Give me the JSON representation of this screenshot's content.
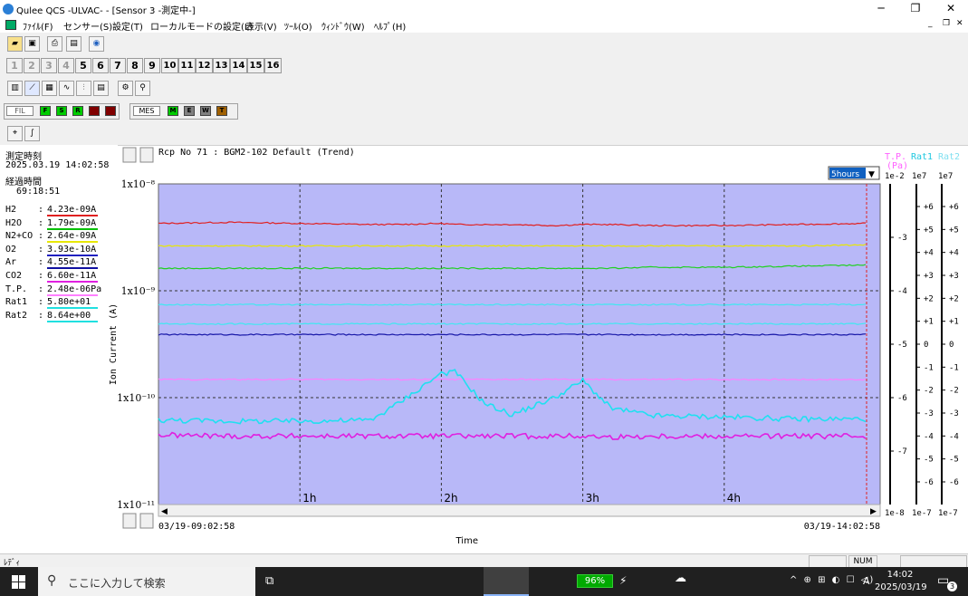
{
  "window": {
    "title": "Qulee QCS  -ULVAC-   - [Sensor 3 -測定中-]",
    "controls": {
      "minimize": "─",
      "restore": "❐",
      "close": "✕"
    }
  },
  "menu": [
    "ﾌｧｲﾙ(F)",
    "センサー(S)",
    "設定(T)",
    "ローカルモードの設定(L)",
    "表示(V)",
    "ﾂｰﾙ(O)",
    "ｳｨﾝﾄﾞｳ(W)",
    "ﾍﾙﾌﾟ(H)"
  ],
  "mdi_controls": {
    "minimize": "_",
    "restore": "❐",
    "close": "✕"
  },
  "sensor_tabs": [
    {
      "label": "1",
      "enabled": false
    },
    {
      "label": "2",
      "enabled": false
    },
    {
      "label": "3",
      "enabled": false
    },
    {
      "label": "4",
      "enabled": false
    },
    {
      "label": "5",
      "enabled": true
    },
    {
      "label": "6",
      "enabled": true
    },
    {
      "label": "7",
      "enabled": true
    },
    {
      "label": "8",
      "enabled": true
    },
    {
      "label": "9",
      "enabled": true
    },
    {
      "label": "10",
      "enabled": true
    },
    {
      "label": "11",
      "enabled": true
    },
    {
      "label": "12",
      "enabled": true
    },
    {
      "label": "13",
      "enabled": true
    },
    {
      "label": "14",
      "enabled": true
    },
    {
      "label": "15",
      "enabled": true
    },
    {
      "label": "16",
      "enabled": true
    }
  ],
  "filter_bar": {
    "fil_label": "FIL",
    "fil_chips": [
      {
        "label": "F",
        "color": "#00cc00"
      },
      {
        "label": "S",
        "color": "#00cc00"
      },
      {
        "label": "R",
        "color": "#00cc00"
      },
      {
        "label": "",
        "color": "#800000"
      },
      {
        "label": "",
        "color": "#800000"
      }
    ],
    "mes_label": "MES",
    "mes_chips": [
      {
        "label": "M",
        "color": "#00cc00"
      },
      {
        "label": "E",
        "color": "#808080"
      },
      {
        "label": "W",
        "color": "#808080"
      },
      {
        "label": "T",
        "color": "#a06000"
      }
    ]
  },
  "measure": {
    "time_label": "測定時刻",
    "time_value": "2025.03.19 14:02:58",
    "elapsed_label": "経過時間",
    "elapsed_value": "69:18:51"
  },
  "readings": [
    {
      "name": "H2",
      "value": "4.23e-09A",
      "color": "#e02020"
    },
    {
      "name": "H2O",
      "value": "1.79e-09A",
      "color": "#00c000"
    },
    {
      "name": "N2+CO",
      "value": "2.64e-09A",
      "color": "#e8e800"
    },
    {
      "name": "O2",
      "value": "3.93e-10A",
      "color": "#2020c0"
    },
    {
      "name": "Ar",
      "value": "4.55e-11A",
      "color": "#1010a0"
    },
    {
      "name": "CO2",
      "value": "6.60e-11A",
      "color": "#e020e0"
    },
    {
      "name": "T.P.",
      "value": "2.48e-06Pa",
      "color": "#ff80ff"
    },
    {
      "name": "Rat1",
      "value": "5.80e+01",
      "color": "#20e0e0"
    },
    {
      "name": "Rat2",
      "value": "8.64e+00",
      "color": "#20e0e0"
    }
  ],
  "chart_header": {
    "recipe": "Rcp No 71 : BGM2-102 Default (Trend)",
    "range_select": "5hours",
    "right_labels": {
      "tp": "T.P.",
      "tp_unit": "(Pa)",
      "rat1": "Rat1",
      "rat2": "Rat2"
    }
  },
  "chart_data": {
    "type": "line",
    "ylabel": "Ion Current (A)",
    "xlabel": "Time",
    "x_start": "03/19-09:02:58",
    "x_end": "03/19-14:02:58",
    "x_ticks": [
      "1h",
      "2h",
      "3h",
      "4h"
    ],
    "y_ticks": [
      "1x10⁻⁸",
      "1x10⁻⁹",
      "1x10⁻¹⁰",
      "1x10⁻¹¹"
    ],
    "ylim_log": [
      -11,
      -8
    ],
    "yscale": "log",
    "grid": true,
    "background": "#b8b8f8",
    "tp_axis": {
      "top": "1e-2",
      "bottom": "1e-8",
      "ticks": [
        "-3",
        "-4",
        "-5",
        "-6",
        "-7"
      ]
    },
    "rat1_axis": {
      "top": "1e7",
      "bottom": "1e-7",
      "ticks": [
        "+6",
        "+5",
        "+4",
        "+3",
        "+2",
        "+1",
        "0",
        "-1",
        "-2",
        "-3",
        "-4",
        "-5",
        "-6"
      ]
    },
    "rat2_axis": {
      "top": "1e7",
      "bottom": "1e-7",
      "ticks": [
        "+6",
        "+5",
        "+4",
        "+3",
        "+2",
        "+1",
        "0",
        "-1",
        "-2",
        "-3",
        "-4",
        "-5",
        "-6"
      ]
    },
    "x_hours": [
      0,
      0.5,
      1,
      1.5,
      1.7,
      2.0,
      2.1,
      2.3,
      2.5,
      2.8,
      3.0,
      3.2,
      3.5,
      4.0,
      4.5,
      5.0
    ],
    "series": [
      {
        "color": "#e02020",
        "log_values": [
          -8.37,
          -8.36,
          -8.37,
          -8.38,
          -8.38,
          -8.37,
          -8.38,
          -8.38,
          -8.38,
          -8.39,
          -8.38,
          -8.38,
          -8.39,
          -8.39,
          -8.38,
          -8.37
        ]
      },
      {
        "color": "#e8e800",
        "log_values": [
          -8.58,
          -8.58,
          -8.58,
          -8.58,
          -8.58,
          -8.58,
          -8.58,
          -8.58,
          -8.58,
          -8.58,
          -8.58,
          -8.58,
          -8.58,
          -8.58,
          -8.58,
          -8.57
        ]
      },
      {
        "color": "#20d020",
        "log_values": [
          -8.79,
          -8.79,
          -8.79,
          -8.79,
          -8.79,
          -8.79,
          -8.79,
          -8.79,
          -8.79,
          -8.79,
          -8.79,
          -8.79,
          -8.78,
          -8.78,
          -8.77,
          -8.76
        ]
      },
      {
        "color": "#40e8f0",
        "log_values": [
          -9.13,
          -9.13,
          -9.13,
          -9.13,
          -9.13,
          -9.13,
          -9.13,
          -9.13,
          -9.13,
          -9.13,
          -9.13,
          -9.13,
          -9.13,
          -9.13,
          -9.13,
          -9.13
        ]
      },
      {
        "color": "#40e8f0",
        "log_values": [
          -9.31,
          -9.31,
          -9.31,
          -9.31,
          -9.31,
          -9.31,
          -9.31,
          -9.31,
          -9.31,
          -9.31,
          -9.31,
          -9.31,
          -9.31,
          -9.31,
          -9.31,
          -9.31
        ]
      },
      {
        "color": "#1818a8",
        "log_values": [
          -9.41,
          -9.41,
          -9.41,
          -9.41,
          -9.41,
          -9.41,
          -9.41,
          -9.41,
          -9.41,
          -9.41,
          -9.41,
          -9.41,
          -9.41,
          -9.41,
          -9.41,
          -9.41
        ]
      },
      {
        "color": "#ff80ff",
        "log_values": [
          -9.83,
          -9.83,
          -9.83,
          -9.83,
          -9.83,
          -9.83,
          -9.83,
          -9.83,
          -9.83,
          -9.83,
          -9.83,
          -9.83,
          -9.83,
          -9.83,
          -9.83,
          -9.83
        ]
      },
      {
        "color": "#20e0f0",
        "log_values": [
          -10.21,
          -10.22,
          -10.22,
          -10.21,
          -10.05,
          -9.77,
          -9.76,
          -10.05,
          -10.16,
          -10.0,
          -9.84,
          -10.1,
          -10.17,
          -10.18,
          -10.2,
          -10.2
        ]
      },
      {
        "color": "#e020e0",
        "log_values": [
          -10.35,
          -10.36,
          -10.36,
          -10.36,
          -10.36,
          -10.36,
          -10.36,
          -10.36,
          -10.36,
          -10.36,
          -10.36,
          -10.37,
          -10.36,
          -10.36,
          -10.36,
          -10.36
        ]
      }
    ]
  },
  "status": {
    "left": "ﾚﾃﾞｨ",
    "num": "NUM"
  },
  "taskbar": {
    "search_placeholder": "ここに入力して検索",
    "battery": "96%",
    "time": "14:02",
    "date": "2025/03/19",
    "ime": "A",
    "notify_count": "3"
  }
}
